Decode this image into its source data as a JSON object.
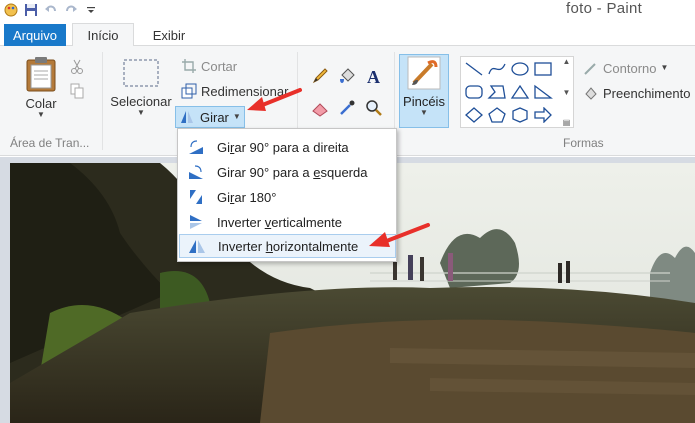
{
  "window": {
    "title": "foto - Paint"
  },
  "tabs": {
    "file": "Arquivo",
    "home": "Início",
    "view": "Exibir"
  },
  "clipboard": {
    "paste_label": "Colar",
    "group_label": "Área de Tran..."
  },
  "image": {
    "select_label": "Selecionar",
    "crop_label": "Cortar",
    "resize_label": "Redimensionar",
    "rotate_label": "Girar"
  },
  "brushes": {
    "label": "Pincéis"
  },
  "shapes": {
    "outline_label": "Contorno",
    "fill_label": "Preenchimento",
    "group_label": "Formas"
  },
  "rotate_menu": {
    "items": [
      {
        "pre": "Gi",
        "ul": "r",
        "post": "ar 90° para a direita"
      },
      {
        "pre": "Girar 90° para a ",
        "ul": "e",
        "post": "squerda"
      },
      {
        "pre": "Gi",
        "ul": "r",
        "post": "ar 180°"
      },
      {
        "pre": "Inverter ",
        "ul": "v",
        "post": "erticalmente"
      },
      {
        "pre": "Inverter ",
        "ul": "h",
        "post": "orizontalmente"
      }
    ]
  },
  "colors": {
    "accent": "#1979ca",
    "highlight": "#c5e3f8",
    "arrow": "#e8302a"
  }
}
